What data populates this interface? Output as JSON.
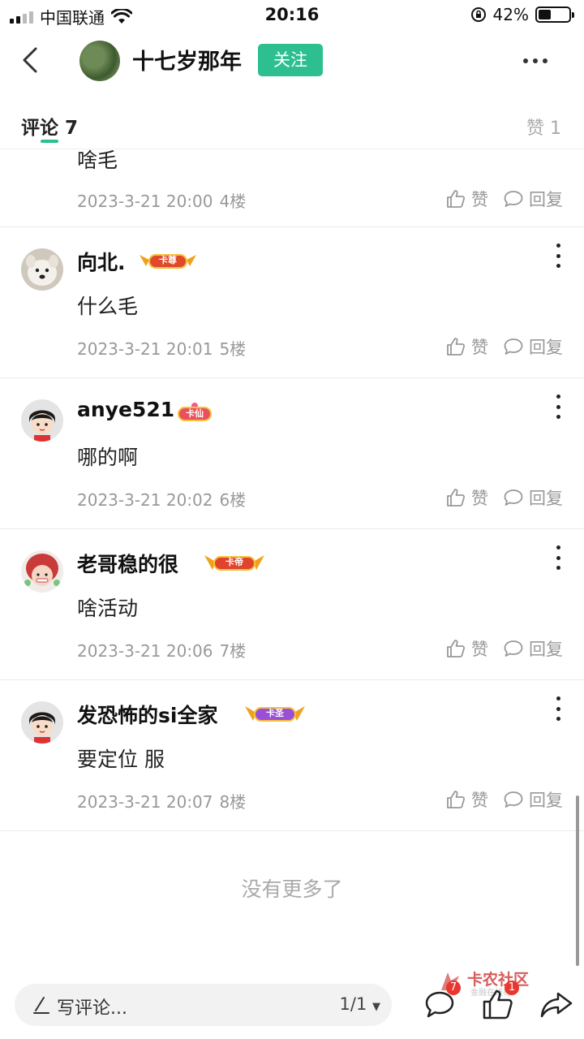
{
  "status_bar": {
    "carrier": "中国联通",
    "time": "20:16",
    "battery": "42%",
    "battery_level": 0.42
  },
  "header": {
    "username": "十七岁那年",
    "follow_label": "关注"
  },
  "tabs": {
    "comments_label": "评论 7",
    "likes_label": "赞 1"
  },
  "comments": [
    {
      "content": "啥毛",
      "time": "2023-3-21 20:00",
      "floor": "4楼",
      "like_label": "赞",
      "reply_label": "回复"
    },
    {
      "username": "向北.",
      "badge": "卡尊",
      "content": "什么毛",
      "time": "2023-3-21 20:01",
      "floor": "5楼",
      "like_label": "赞",
      "reply_label": "回复"
    },
    {
      "username": "anye521",
      "badge": "卡仙",
      "content": "哪的啊",
      "time": "2023-3-21 20:02",
      "floor": "6楼",
      "like_label": "赞",
      "reply_label": "回复"
    },
    {
      "username": "老哥稳的很",
      "badge": "卡帝",
      "content": "啥活动",
      "time": "2023-3-21 20:06",
      "floor": "7楼",
      "like_label": "赞",
      "reply_label": "回复"
    },
    {
      "username": "发恐怖的si全家",
      "badge": "卡圣",
      "content": "要定位 服",
      "time": "2023-3-21 20:07",
      "floor": "8楼",
      "like_label": "赞",
      "reply_label": "回复"
    }
  ],
  "no_more": "没有更多了",
  "bottom_bar": {
    "write_placeholder": "写评论...",
    "page_indicator": "1/1",
    "comment_count": "7",
    "like_count": "1"
  },
  "watermark": {
    "title": "卡农社区",
    "subtitle": "金融在线有"
  },
  "colors": {
    "accent": "#2dbf8f",
    "badge_red": "#e8372f"
  }
}
